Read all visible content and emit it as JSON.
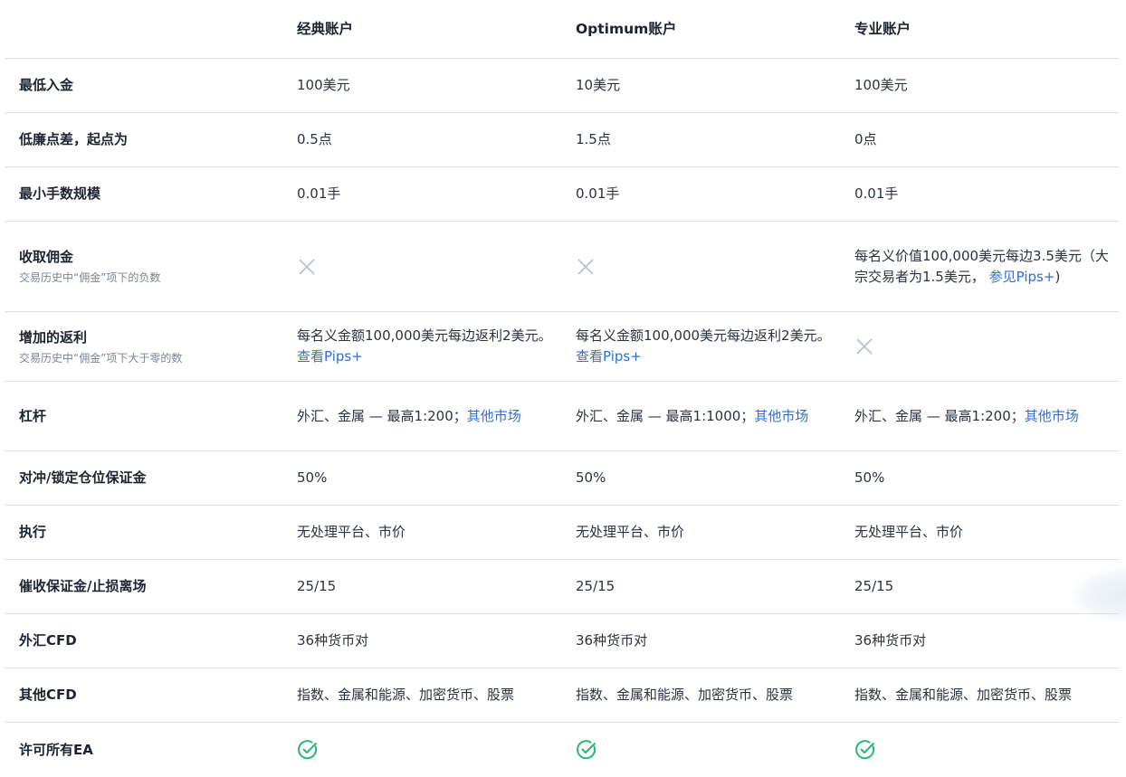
{
  "header": {
    "col1": "经典账户",
    "col2": "Optimum账户",
    "col3": "专业账户"
  },
  "rows": [
    {
      "label": "最低入金",
      "v1": "100美元",
      "v2": "10美元",
      "v3": "100美元"
    },
    {
      "label": "低廉点差，起点为",
      "v1": "0.5点",
      "v2": "1.5点",
      "v3": "0点"
    },
    {
      "label": "最小手数规模",
      "v1": "0.01手",
      "v2": "0.01手",
      "v3": "0.01手"
    },
    {
      "label": "收取佣金",
      "sublabel": "交易历史中“佣金”项下的负数",
      "v1_icon": "cross-icon",
      "v2_icon": "cross-icon",
      "v3_text": "每名义价值100,000美元每边3.5美元（大宗交易者为1.5美元，",
      "v3_link": "参见Pips+",
      "v3_tail": ")"
    },
    {
      "label": "增加的返利",
      "sublabel": "交易历史中“佣金”项下大于零的数",
      "v1_text": "每名义金额100,000美元每边返利2美元。",
      "v1_link": "查看Pips+",
      "v2_text": "每名义金额100,000美元每边返利2美元。",
      "v2_link": "查看Pips+",
      "v3_icon": "cross-icon"
    },
    {
      "label": "杠杆",
      "v1_text": "外汇、金属 — 最高1:200；",
      "v1_link": "其他市场",
      "v2_text": "外汇、金属 — 最高1:1000；",
      "v2_link": "其他市场",
      "v3_text": "外汇、金属 — 最高1:200；",
      "v3_link": "其他市场"
    },
    {
      "label": "对冲/锁定仓位保证金",
      "v1": "50%",
      "v2": "50%",
      "v3": "50%"
    },
    {
      "label": "执行",
      "v1": "无处理平台、市价",
      "v2": "无处理平台、市价",
      "v3": "无处理平台、市价"
    },
    {
      "label": "催收保证金/止损离场",
      "v1": "25/15",
      "v2": "25/15",
      "v3": "25/15"
    },
    {
      "label": "外汇CFD",
      "v1": "36种货币对",
      "v2": "36种货币对",
      "v3": "36种货币对"
    },
    {
      "label": "其他CFD",
      "v1": "指数、金属和能源、加密货币、股票",
      "v2": "指数、金属和能源、加密货币、股票",
      "v3": "指数、金属和能源、加密货币、股票"
    },
    {
      "label": "许可所有EA",
      "v1_icon": "check-icon",
      "v2_icon": "check-icon",
      "v3_icon": "check-icon"
    }
  ],
  "colors": {
    "link": "#2f6fd6",
    "check": "#2bb673",
    "cross": "#b9c2cf",
    "divider": "#dde2e8"
  }
}
